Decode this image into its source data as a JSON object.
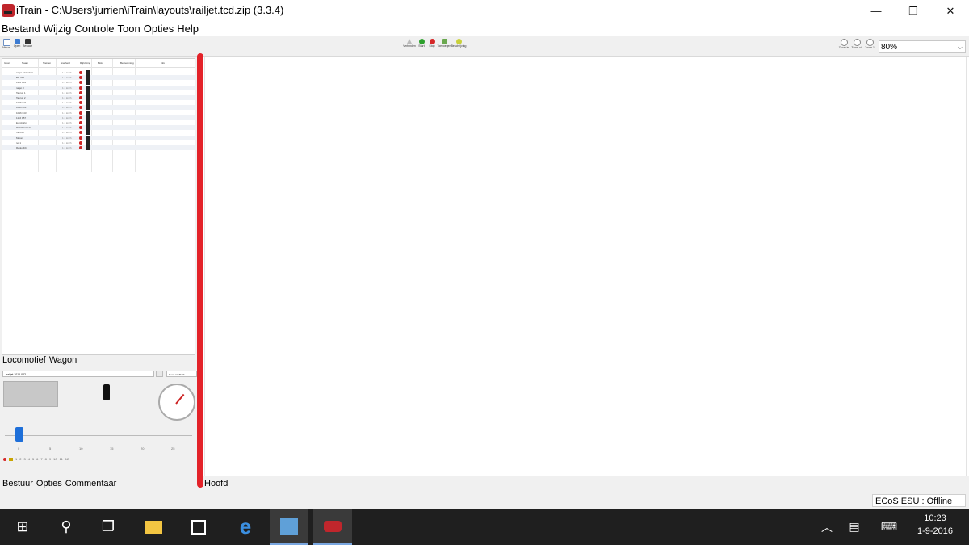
{
  "window": {
    "title": "iTrain - C:\\Users\\jurrien\\iTrain\\layouts\\railjet.tcd.zip (3.3.4)",
    "minimize": "—",
    "restore": "❐",
    "close": "✕"
  },
  "menu": [
    "Bestand",
    "Wijzig",
    "Controle",
    "Toon",
    "Opties",
    "Help"
  ],
  "toolbar": {
    "left": [
      "Nieuw",
      "Open",
      "Bewaar"
    ],
    "center": [
      "Verbinden",
      "Start",
      "Stop",
      "Toevoegen",
      "Beschrijving"
    ],
    "right": [
      "Zoom in",
      "Zoom uit",
      "Zoom 1"
    ],
    "zoom": "80%"
  },
  "table": {
    "headers": [
      "Icoon",
      "Naam",
      "Treinen",
      "Snelheid",
      "Rijrichting",
      "Blok",
      "Bestemming",
      "Info"
    ],
    "rows": [
      "railjet 1016 022",
      "BR 374",
      "1116 001",
      "railjet 3",
      "Taurus 1",
      "Taurus 2",
      "1016 041",
      "1016 001",
      "1016 043",
      "1116 157",
      "Eurobahn",
      "RHEINGOLD",
      "Vectron",
      "Messi",
      "ret 1",
      "Regio 404"
    ],
    "cell_dots": "1.1 km/h",
    "cell_min": "-"
  },
  "loco_panel": {
    "tabs": [
      "Locomotief",
      "Wagon"
    ],
    "selected": "railjet 1016 022",
    "mode": "Geen snelheid",
    "ticks": [
      "0",
      "5",
      "10",
      "15",
      "20",
      "25"
    ],
    "functions": [
      "0",
      "1",
      "2",
      "3",
      "4",
      "5",
      "6",
      "7",
      "8",
      "9",
      "10",
      "11",
      "12"
    ]
  },
  "left_bottom_tabs": [
    "Bestuur",
    "Opties",
    "Commentaar"
  ],
  "main_tab": "Hoofd",
  "status": "ECoS ESU :  Offline",
  "taskbar": {
    "time": "10:23",
    "date": "1-9-2016"
  }
}
